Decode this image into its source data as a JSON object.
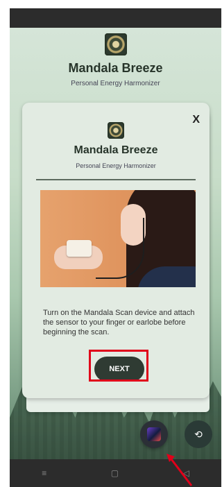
{
  "header": {
    "title": "Mandala Breeze",
    "subtitle": "Personal Energy Harmonizer"
  },
  "modal": {
    "close_label": "X",
    "title": "Mandala Breeze",
    "subtitle": "Personal Energy Harmonizer",
    "instruction": "Turn on the Mandala Scan device and attach the sensor to your finger or earlobe before beginning the scan.",
    "next_label": "NEXT"
  },
  "fabs": {
    "back_label": "⟲"
  },
  "navbar": {
    "menu_icon": "≡",
    "home_icon": "▢",
    "back_icon": "◁"
  },
  "colors": {
    "primary_button": "#2f3b33",
    "highlight": "#e0001a"
  }
}
